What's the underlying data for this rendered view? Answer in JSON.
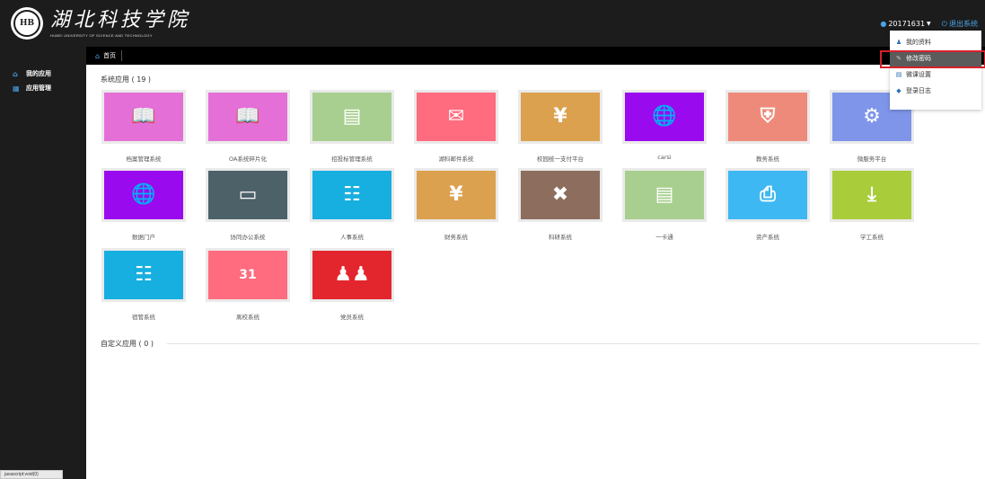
{
  "header": {
    "logo_seal": "湖北科技",
    "logo_cn": "湖北科技学院",
    "logo_en": "HUBEI UNIVERSITY OF SCIENCE AND TECHNOLOGY",
    "user_id": "20171631",
    "logout_label": "退出系统"
  },
  "dropdown": {
    "items": [
      {
        "label": "我的资料",
        "icon": "user-icon"
      },
      {
        "label": "修改密码",
        "icon": "pencil-icon"
      },
      {
        "label": "微课设置",
        "icon": "card-icon"
      },
      {
        "label": "登录日志",
        "icon": "tag-icon"
      }
    ]
  },
  "sidebar": {
    "items": [
      {
        "label": "我的应用",
        "icon": "home-icon"
      },
      {
        "label": "应用管理",
        "icon": "grid-icon"
      }
    ]
  },
  "status_tip": "javascript:void(0)",
  "breadcrumb": {
    "home_label": "首页"
  },
  "sections": {
    "system_title": "系统应用 ( 19 )",
    "custom_title": "自定义应用 ( 0 )"
  },
  "apps": [
    {
      "label": "档案管理系统",
      "color": "#e46fd6",
      "icon": "book-icon"
    },
    {
      "label": "OA系统碎片化",
      "color": "#e46fd6",
      "icon": "book-icon"
    },
    {
      "label": "招投标管理系统",
      "color": "#a8cf8f",
      "icon": "id-card-icon"
    },
    {
      "label": "湖科邮件系统",
      "color": "#ff6b7f",
      "icon": "envelope-icon"
    },
    {
      "label": "校园统一支付平台",
      "color": "#dba14f",
      "icon": "money-hand-icon"
    },
    {
      "label": "carsi",
      "color": "#9a0aee",
      "icon": "globe-laptop-icon"
    },
    {
      "label": "教务系统",
      "color": "#ee8a7a",
      "icon": "briefcase-icon"
    },
    {
      "label": "微服务平台",
      "color": "#7f95e9",
      "icon": "database-gear-icon"
    },
    {
      "label": "数据门户",
      "color": "#9a0aee",
      "icon": "globe-laptop-icon"
    },
    {
      "label": "协同办公系统",
      "color": "#4d6169",
      "icon": "monitor-icon"
    },
    {
      "label": "人事系统",
      "color": "#17aee0",
      "icon": "contact-book-icon"
    },
    {
      "label": "财务系统",
      "color": "#dba14f",
      "icon": "money-hand-icon"
    },
    {
      "label": "科研系统",
      "color": "#8c6d5e",
      "icon": "tools-icon"
    },
    {
      "label": "一卡通",
      "color": "#a8cf8f",
      "icon": "id-card-icon"
    },
    {
      "label": "资产系统",
      "color": "#3db8f2",
      "icon": "printer-icon"
    },
    {
      "label": "学工系统",
      "color": "#a9cc3a",
      "icon": "download-tray-icon"
    },
    {
      "label": "宿管系统",
      "color": "#17aee0",
      "icon": "contact-book-icon"
    },
    {
      "label": "离校系统",
      "color": "#ff6b7f",
      "icon": "calendar-icon"
    },
    {
      "label": "党员系统",
      "color": "#e3262d",
      "icon": "users-icon"
    }
  ]
}
